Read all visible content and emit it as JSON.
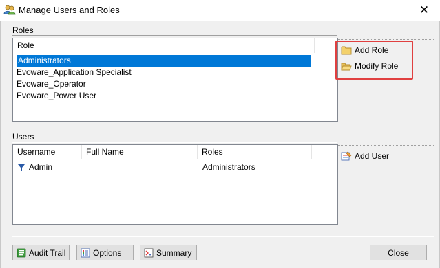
{
  "window": {
    "title": "Manage Users and Roles",
    "close_glyph": "✕"
  },
  "roles": {
    "section_label": "Roles",
    "column_header": "Role",
    "items": [
      "Administrators",
      "Evoware_Application Specialist",
      "Evoware_Operator",
      "Evoware_Power User"
    ],
    "selected_index": 0,
    "add_label": "Add Role",
    "modify_label": "Modify Role"
  },
  "users": {
    "section_label": "Users",
    "columns": [
      "Username",
      "Full Name",
      "Roles"
    ],
    "rows": [
      {
        "username": "Admin",
        "full_name": "",
        "roles": "Administrators"
      }
    ],
    "add_label": "Add User"
  },
  "footer": {
    "audit_label": "Audit Trail",
    "options_label": "Options",
    "summary_label": "Summary",
    "close_label": "Close"
  },
  "colors": {
    "selection": "#0078d7",
    "highlight_box": "#e04040"
  },
  "icons": {
    "title": "users-roles-icon",
    "add_role": "folder-icon",
    "modify_role": "open-folder-icon",
    "add_user": "add-user-icon",
    "user_row": "user-filter-icon",
    "audit": "audit-trail-icon",
    "options": "options-icon",
    "summary": "summary-icon"
  }
}
